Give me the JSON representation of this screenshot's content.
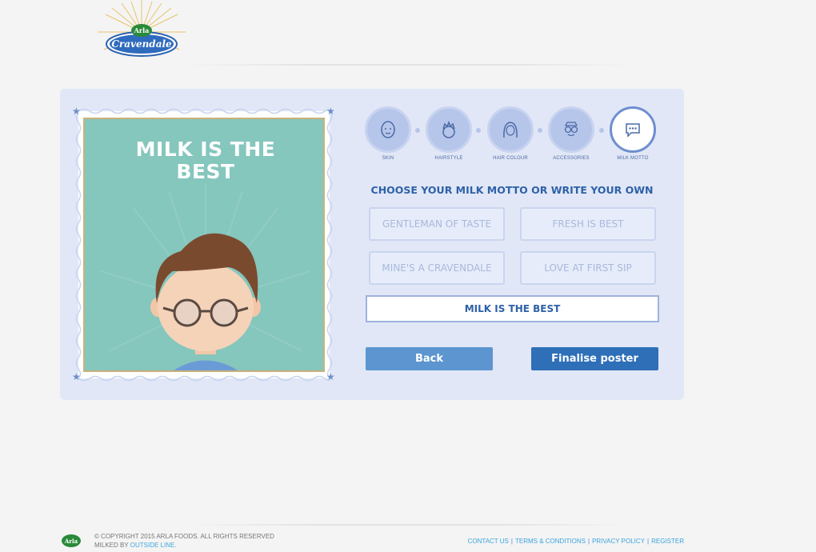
{
  "header": {
    "logo_brand_small": "Arla",
    "logo_brand": "Cravendale"
  },
  "poster": {
    "motto": "MILK IS THE BEST"
  },
  "steps": [
    {
      "label": "SKIN",
      "icon": "face-icon",
      "active": false
    },
    {
      "label": "HAIRSTYLE",
      "icon": "hairstyle-icon",
      "active": false
    },
    {
      "label": "HAIR COLOUR",
      "icon": "hair-colour-icon",
      "active": false
    },
    {
      "label": "ACCESSORIES",
      "icon": "glasses-icon",
      "active": false
    },
    {
      "label": "MILK MOTTO",
      "icon": "speech-bubble-icon",
      "active": true
    }
  ],
  "heading": "CHOOSE YOUR MILK MOTTO OR WRITE YOUR OWN",
  "mottos": [
    "GENTLEMAN OF TASTE",
    "FRESH IS BEST",
    "MINE'S A CRAVENDALE",
    "LOVE AT FIRST SIP"
  ],
  "motto_input_value": "MILK IS THE BEST",
  "buttons": {
    "back": "Back",
    "finalise": "Finalise poster"
  },
  "footer": {
    "copyright": "© COPYRIGHT 2015 ARLA FOODS. ALL RIGHTS RESERVED",
    "milked_by": "MILKED BY",
    "milked_by_link": "OUTSIDE LINE.",
    "links": [
      "CONTACT US",
      "TERMS & CONDITIONS",
      "PRIVACY POLICY",
      "REGISTER"
    ],
    "logo_text": "Arla"
  },
  "colors": {
    "accent_blue": "#2e6fb8",
    "panel_bg": "#e1e7f6",
    "poster_bg": "#85c6bd"
  }
}
